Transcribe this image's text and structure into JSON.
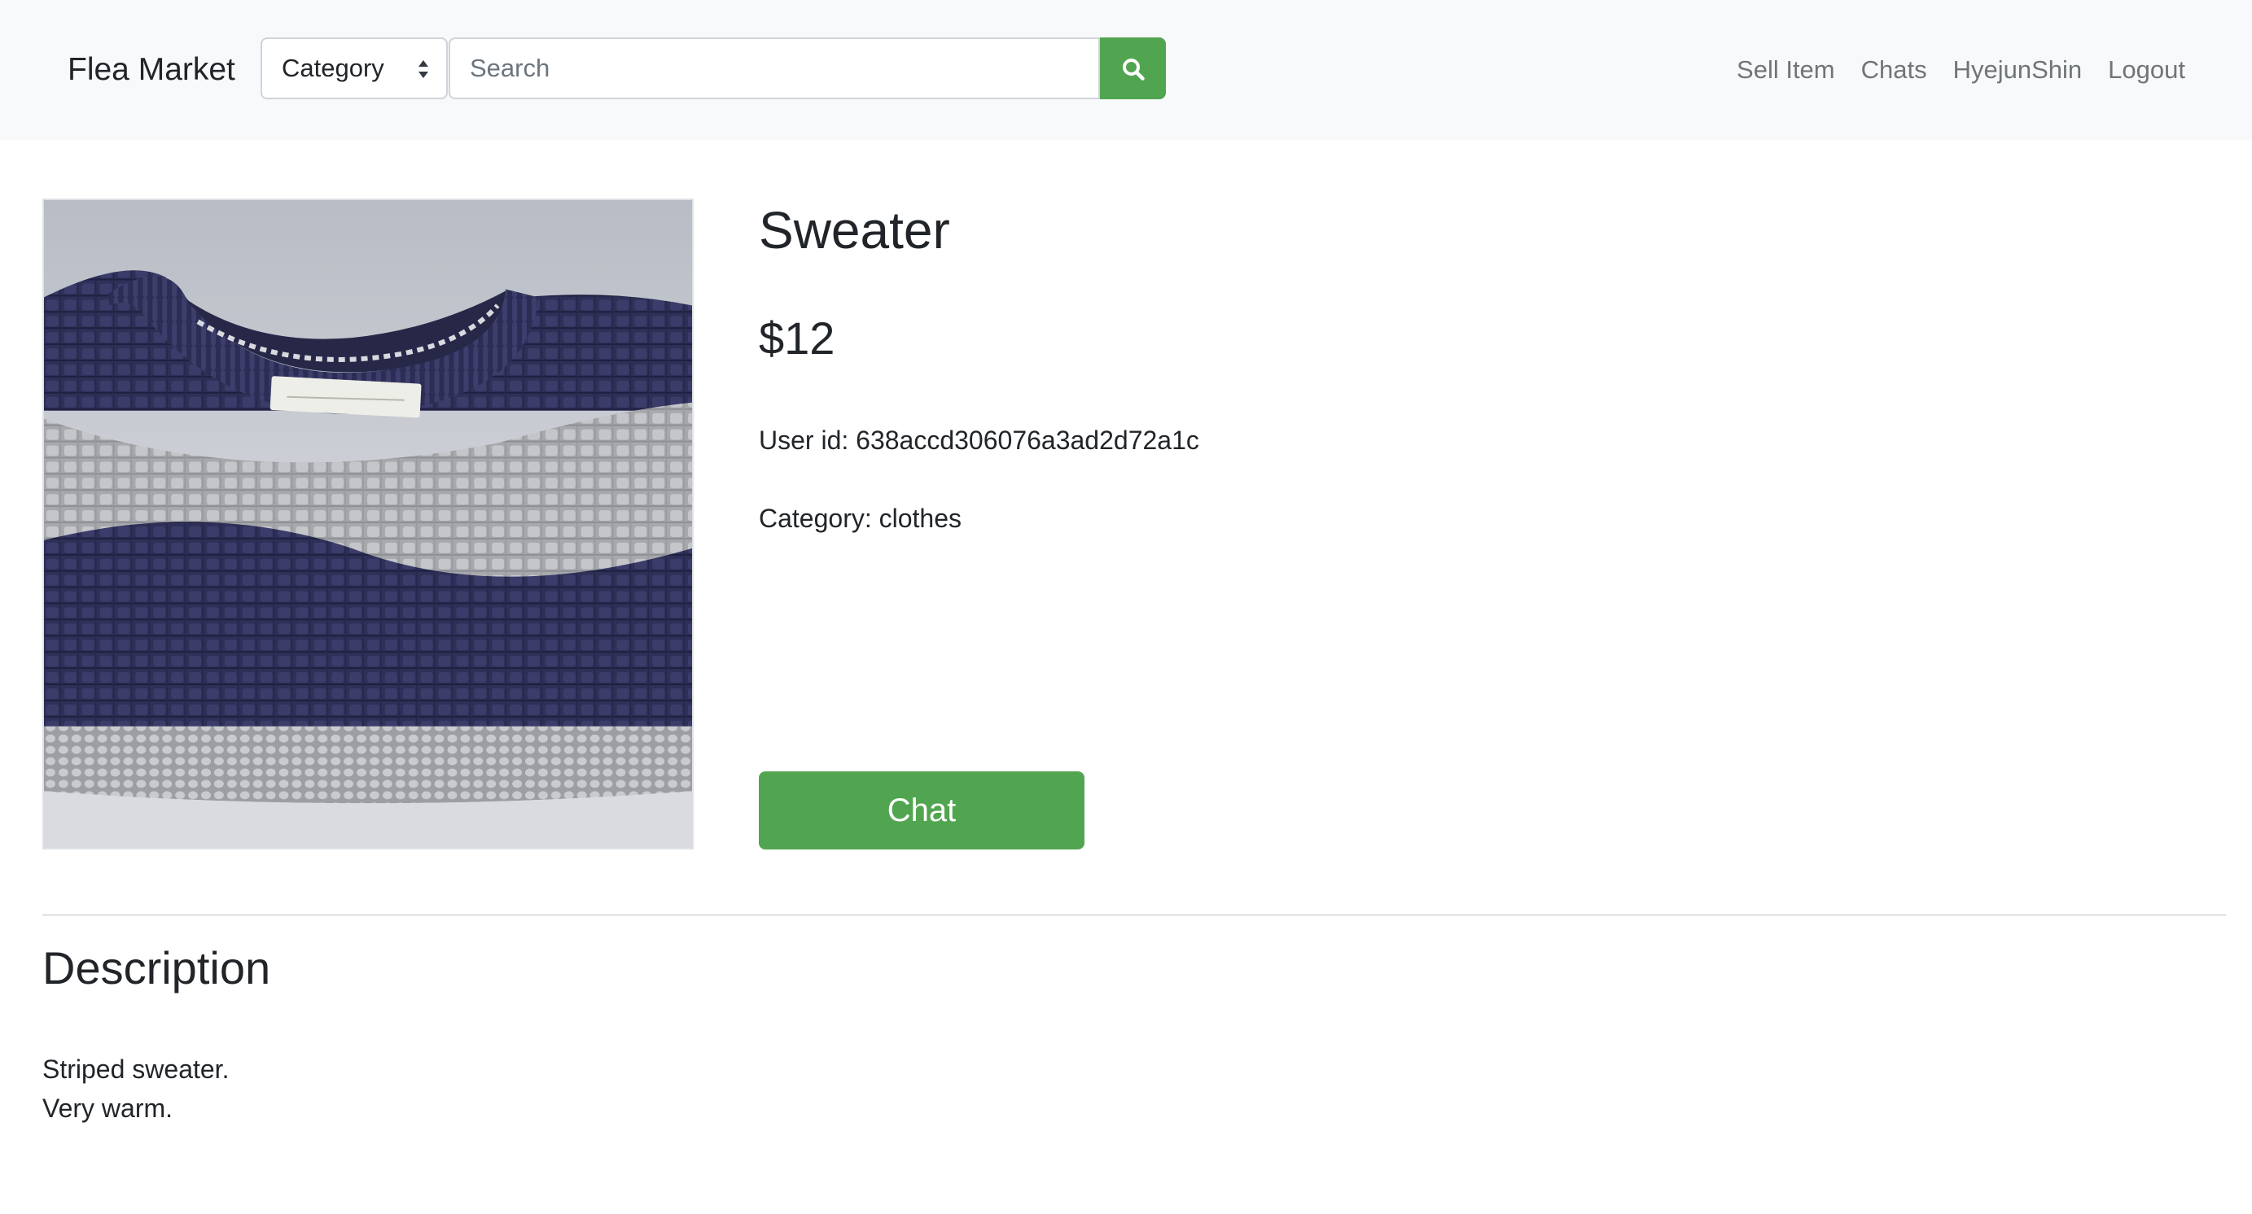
{
  "navbar": {
    "brand": "Flea Market",
    "category_select": {
      "selected": "Category"
    },
    "search": {
      "placeholder": "Search",
      "value": ""
    },
    "search_button_icon": "search-icon",
    "links": [
      "Sell Item",
      "Chats",
      "HyejunShin",
      "Logout"
    ]
  },
  "product": {
    "image_icon": "striped-sweater-photo",
    "title": "Sweater",
    "price": "$12",
    "user_id": "User id: 638accd306076a3ad2d72a1c",
    "category": "Category: clothes",
    "chat_button": "Chat"
  },
  "description": {
    "heading": "Description",
    "lines": [
      "Striped sweater.",
      "Very warm."
    ]
  },
  "colors": {
    "accent": "#52a550",
    "navbar_bg": "#f8f9fa",
    "text": "#212529",
    "nav_link": "#6f7579"
  }
}
